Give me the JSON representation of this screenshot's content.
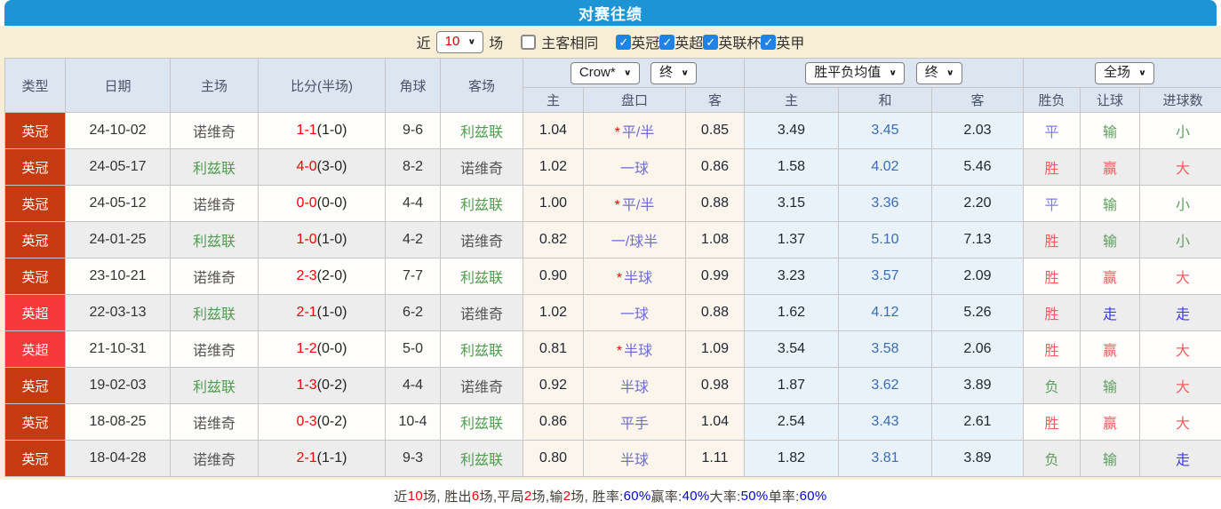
{
  "title": "对赛往绩",
  "colors": {
    "title_bar": "#1d95d4",
    "panel_cream": "#f8eed6",
    "header_bg": "#dce5f0",
    "league_championship": "#c63a11",
    "league_premier": "#f8393b",
    "odds_bg": "#fbf5ec",
    "wdl_bg": "#e9f2f8",
    "checkbox_on": "#1e82e6",
    "score_red": "#ff0000",
    "team_green": "#4f9d4f",
    "result_red": "#f15e5e",
    "result_green": "#5d9e5d",
    "result_blue": "#3a3aee"
  },
  "filter": {
    "near_label": "近",
    "near_value": "10",
    "games_label": "场",
    "same_venue": {
      "label": "主客相同",
      "checked": false
    },
    "leagues": [
      {
        "label": "英冠",
        "checked": true
      },
      {
        "label": "英超",
        "checked": true
      },
      {
        "label": "英联杯",
        "checked": true
      },
      {
        "label": "英甲",
        "checked": true
      }
    ]
  },
  "table": {
    "headers": {
      "type": "类型",
      "date": "日期",
      "home": "主场",
      "score": "比分(半场)",
      "corner": "角球",
      "away": "客场",
      "odds_company_select": "Crow*",
      "odds_state_select": "终",
      "odds_home": "主",
      "odds_handicap": "盘口",
      "odds_away": "客",
      "wdl_select": "胜平负均值",
      "wdl_state_select": "终",
      "wdl_home": "主",
      "wdl_draw": "和",
      "wdl_away": "客",
      "scope_select": "全场",
      "result": "胜负",
      "handicap_result": "让球",
      "goals_result": "进球数"
    },
    "rows": [
      {
        "league": "英冠",
        "league_style": "yg",
        "date": "24-10-02",
        "home": "诺维奇",
        "home_style": "gray",
        "score_main": "1-1",
        "score_half": "(1-0)",
        "corner": "9-6",
        "away": "利兹联",
        "away_style": "green",
        "odds_home": "1.04",
        "hcp_star": true,
        "handicap": "平/半",
        "odds_away": "0.85",
        "wdl_home": "3.49",
        "wdl_draw": "3.45",
        "wdl_away": "2.03",
        "result": {
          "text": "平",
          "color": "lblue"
        },
        "let": {
          "text": "输",
          "color": "green"
        },
        "goal": {
          "text": "小",
          "color": "green"
        }
      },
      {
        "league": "英冠",
        "league_style": "yg",
        "date": "24-05-17",
        "home": "利兹联",
        "home_style": "green",
        "score_main": "4-0",
        "score_half": "(3-0)",
        "corner": "8-2",
        "away": "诺维奇",
        "away_style": "gray",
        "odds_home": "1.02",
        "hcp_star": false,
        "handicap": "一球",
        "odds_away": "0.86",
        "wdl_home": "1.58",
        "wdl_draw": "4.02",
        "wdl_away": "5.46",
        "result": {
          "text": "胜",
          "color": "red"
        },
        "let": {
          "text": "赢",
          "color": "red"
        },
        "goal": {
          "text": "大",
          "color": "red"
        }
      },
      {
        "league": "英冠",
        "league_style": "yg",
        "date": "24-05-12",
        "home": "诺维奇",
        "home_style": "gray",
        "score_main": "0-0",
        "score_half": "(0-0)",
        "corner": "4-4",
        "away": "利兹联",
        "away_style": "green",
        "odds_home": "1.00",
        "hcp_star": true,
        "handicap": "平/半",
        "odds_away": "0.88",
        "wdl_home": "3.15",
        "wdl_draw": "3.36",
        "wdl_away": "2.20",
        "result": {
          "text": "平",
          "color": "lblue"
        },
        "let": {
          "text": "输",
          "color": "green"
        },
        "goal": {
          "text": "小",
          "color": "green"
        }
      },
      {
        "league": "英冠",
        "league_style": "yg",
        "date": "24-01-25",
        "home": "利兹联",
        "home_style": "green",
        "score_main": "1-0",
        "score_half": "(1-0)",
        "corner": "4-2",
        "away": "诺维奇",
        "away_style": "gray",
        "odds_home": "0.82",
        "hcp_star": false,
        "handicap": "一/球半",
        "odds_away": "1.08",
        "wdl_home": "1.37",
        "wdl_draw": "5.10",
        "wdl_away": "7.13",
        "result": {
          "text": "胜",
          "color": "red"
        },
        "let": {
          "text": "输",
          "color": "green"
        },
        "goal": {
          "text": "小",
          "color": "green"
        }
      },
      {
        "league": "英冠",
        "league_style": "yg",
        "date": "23-10-21",
        "home": "诺维奇",
        "home_style": "gray",
        "score_main": "2-3",
        "score_half": "(2-0)",
        "corner": "7-7",
        "away": "利兹联",
        "away_style": "green",
        "odds_home": "0.90",
        "hcp_star": true,
        "handicap": "半球",
        "odds_away": "0.99",
        "wdl_home": "3.23",
        "wdl_draw": "3.57",
        "wdl_away": "2.09",
        "result": {
          "text": "胜",
          "color": "red"
        },
        "let": {
          "text": "赢",
          "color": "red"
        },
        "goal": {
          "text": "大",
          "color": "red"
        }
      },
      {
        "league": "英超",
        "league_style": "yc",
        "date": "22-03-13",
        "home": "利兹联",
        "home_style": "green",
        "score_main": "2-1",
        "score_half": "(1-0)",
        "corner": "6-2",
        "away": "诺维奇",
        "away_style": "gray",
        "odds_home": "1.02",
        "hcp_star": false,
        "handicap": "一球",
        "odds_away": "0.88",
        "wdl_home": "1.62",
        "wdl_draw": "4.12",
        "wdl_away": "5.26",
        "result": {
          "text": "胜",
          "color": "red"
        },
        "let": {
          "text": "走",
          "color": "blue"
        },
        "goal": {
          "text": "走",
          "color": "blue"
        }
      },
      {
        "league": "英超",
        "league_style": "yc",
        "date": "21-10-31",
        "home": "诺维奇",
        "home_style": "gray",
        "score_main": "1-2",
        "score_half": "(0-0)",
        "corner": "5-0",
        "away": "利兹联",
        "away_style": "green",
        "odds_home": "0.81",
        "hcp_star": true,
        "handicap": "半球",
        "odds_away": "1.09",
        "wdl_home": "3.54",
        "wdl_draw": "3.58",
        "wdl_away": "2.06",
        "result": {
          "text": "胜",
          "color": "red"
        },
        "let": {
          "text": "赢",
          "color": "red"
        },
        "goal": {
          "text": "大",
          "color": "red"
        }
      },
      {
        "league": "英冠",
        "league_style": "yg",
        "date": "19-02-03",
        "home": "利兹联",
        "home_style": "green",
        "score_main": "1-3",
        "score_half": "(0-2)",
        "corner": "4-4",
        "away": "诺维奇",
        "away_style": "gray",
        "odds_home": "0.92",
        "hcp_star": false,
        "handicap": "半球",
        "odds_away": "0.98",
        "wdl_home": "1.87",
        "wdl_draw": "3.62",
        "wdl_away": "3.89",
        "result": {
          "text": "负",
          "color": "green"
        },
        "let": {
          "text": "输",
          "color": "green"
        },
        "goal": {
          "text": "大",
          "color": "red"
        }
      },
      {
        "league": "英冠",
        "league_style": "yg",
        "date": "18-08-25",
        "home": "诺维奇",
        "home_style": "gray",
        "score_main": "0-3",
        "score_half": "(0-2)",
        "corner": "10-4",
        "away": "利兹联",
        "away_style": "green",
        "odds_home": "0.86",
        "hcp_star": false,
        "handicap": "平手",
        "odds_away": "1.04",
        "wdl_home": "2.54",
        "wdl_draw": "3.43",
        "wdl_away": "2.61",
        "result": {
          "text": "胜",
          "color": "red"
        },
        "let": {
          "text": "赢",
          "color": "red"
        },
        "goal": {
          "text": "大",
          "color": "red"
        }
      },
      {
        "league": "英冠",
        "league_style": "yg",
        "date": "18-04-28",
        "home": "诺维奇",
        "home_style": "gray",
        "score_main": "2-1",
        "score_half": "(1-1)",
        "corner": "9-3",
        "away": "利兹联",
        "away_style": "green",
        "odds_home": "0.80",
        "hcp_star": false,
        "handicap": "半球",
        "odds_away": "1.11",
        "wdl_home": "1.82",
        "wdl_draw": "3.81",
        "wdl_away": "3.89",
        "result": {
          "text": "负",
          "color": "green"
        },
        "let": {
          "text": "输",
          "color": "green"
        },
        "goal": {
          "text": "走",
          "color": "blue"
        }
      }
    ]
  },
  "summary": {
    "segments": [
      {
        "text": "近 ",
        "color": "dark"
      },
      {
        "text": "10",
        "color": "red"
      },
      {
        "text": " 场, 胜出 ",
        "color": "dark"
      },
      {
        "text": "6",
        "color": "red"
      },
      {
        "text": " 场,平局 ",
        "color": "dark"
      },
      {
        "text": "2",
        "color": "red"
      },
      {
        "text": " 场,输 ",
        "color": "dark"
      },
      {
        "text": "2",
        "color": "red"
      },
      {
        "text": " 场, 胜率: ",
        "color": "dark"
      },
      {
        "text": "60%",
        "color": "blue"
      },
      {
        "text": " 赢率: ",
        "color": "dark"
      },
      {
        "text": "40%",
        "color": "blue"
      },
      {
        "text": " 大率: ",
        "color": "dark"
      },
      {
        "text": "50%",
        "color": "blue"
      },
      {
        "text": " 单率: ",
        "color": "dark"
      },
      {
        "text": "60%",
        "color": "blue"
      }
    ]
  }
}
